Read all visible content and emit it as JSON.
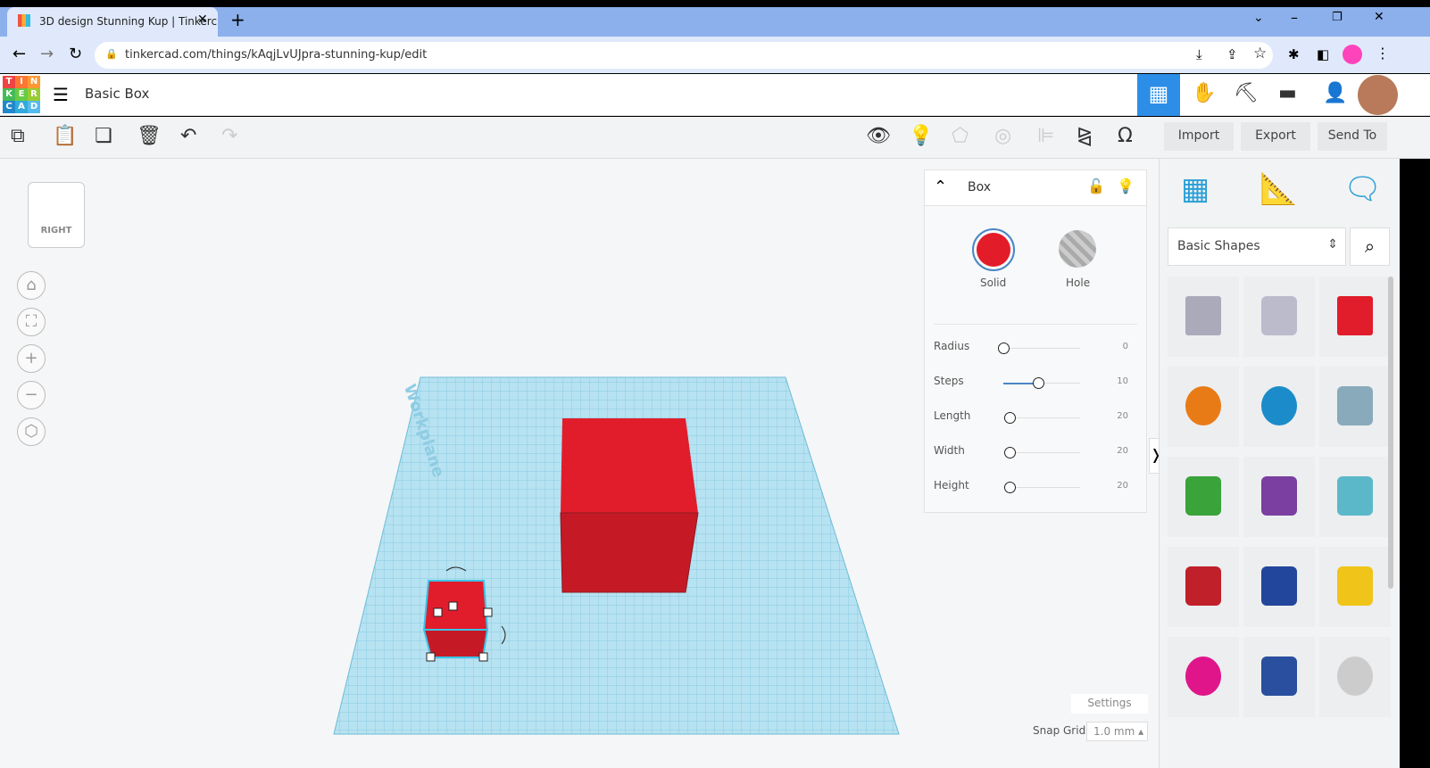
{
  "browser": {
    "tab_title": "3D design Stunning Kup | Tinkerc",
    "url": "tinkercad.com/things/kAqjLvUJpra-stunning-kup/edit"
  },
  "app": {
    "logo": [
      "T",
      "I",
      "N",
      "K",
      "E",
      "R",
      "C",
      "A",
      "D"
    ],
    "design_title": "Basic Box"
  },
  "toolbar": {
    "import": "Import",
    "export": "Export",
    "send_to": "Send To"
  },
  "viewcube": {
    "face": "RIGHT"
  },
  "workplane": {
    "label": "Workplane"
  },
  "inspector": {
    "title": "Box",
    "solid": "Solid",
    "hole": "Hole",
    "color": "#e31c2a",
    "params": [
      {
        "label": "Radius",
        "value": "0",
        "fraction": 0
      },
      {
        "label": "Steps",
        "value": "10",
        "fraction": 0.45
      },
      {
        "label": "Length",
        "value": "20",
        "fraction": 0.08
      },
      {
        "label": "Width",
        "value": "20",
        "fraction": 0.08
      },
      {
        "label": "Height",
        "value": "20",
        "fraction": 0.08
      }
    ]
  },
  "library": {
    "category": "Basic Shapes"
  },
  "footer": {
    "settings": "Settings",
    "snap_label": "Snap Grid",
    "snap_value": "1.0 mm ▴"
  }
}
